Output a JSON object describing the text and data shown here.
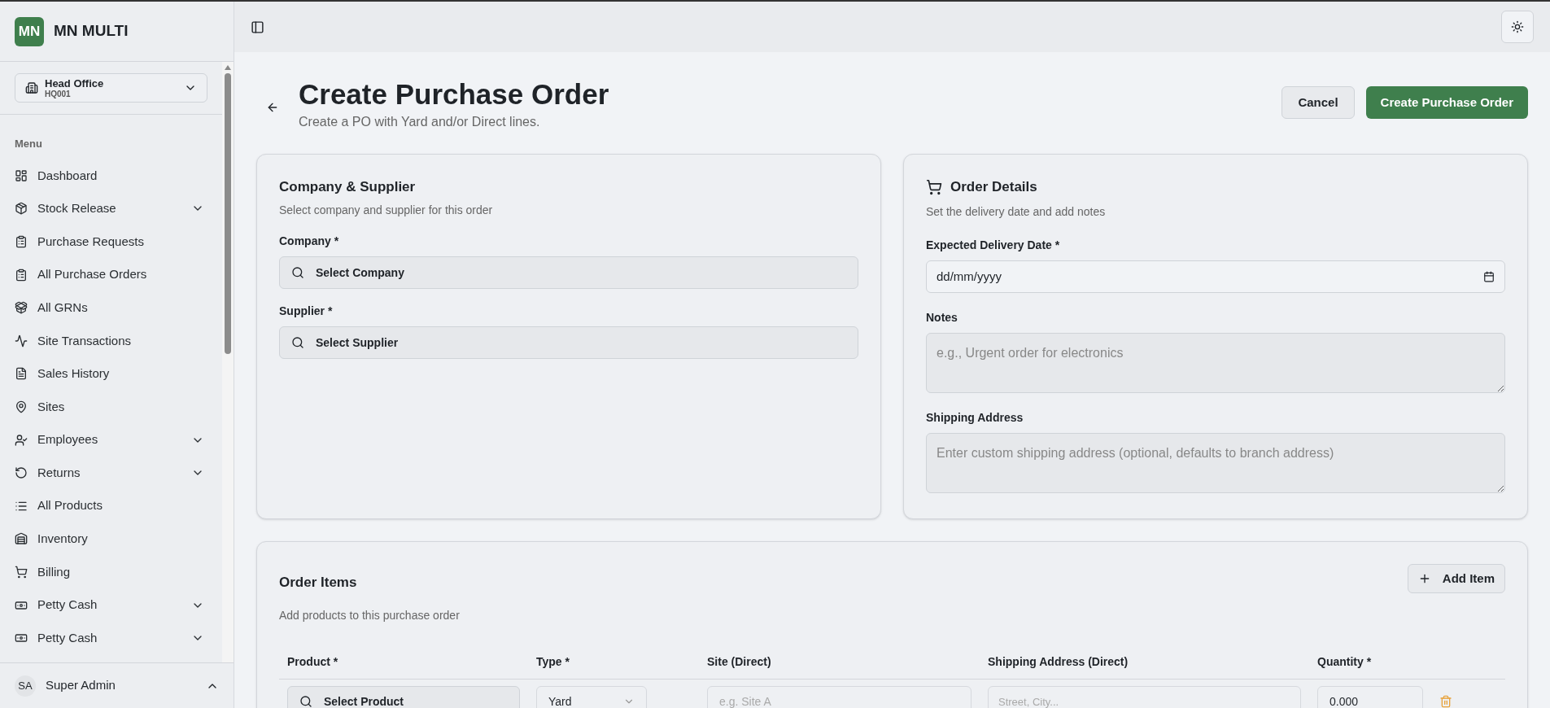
{
  "brand": {
    "logo": "MN",
    "name": "MN MULTI"
  },
  "branch": {
    "name": "Head Office",
    "code": "HQ001"
  },
  "sidebar": {
    "heading": "Menu",
    "items": [
      {
        "label": "Dashboard",
        "expandable": false
      },
      {
        "label": "Stock Release",
        "expandable": true
      },
      {
        "label": "Purchase Requests",
        "expandable": false
      },
      {
        "label": "All Purchase Orders",
        "expandable": false
      },
      {
        "label": "All GRNs",
        "expandable": false
      },
      {
        "label": "Site Transactions",
        "expandable": false
      },
      {
        "label": "Sales History",
        "expandable": false
      },
      {
        "label": "Sites",
        "expandable": false
      },
      {
        "label": "Employees",
        "expandable": true
      },
      {
        "label": "Returns",
        "expandable": true
      },
      {
        "label": "All Products",
        "expandable": false
      },
      {
        "label": "Inventory",
        "expandable": false
      },
      {
        "label": "Billing",
        "expandable": false
      },
      {
        "label": "Petty Cash",
        "expandable": true
      },
      {
        "label": "Petty Cash",
        "expandable": true
      }
    ]
  },
  "user": {
    "initials": "SA",
    "name": "Super Admin"
  },
  "page": {
    "title": "Create Purchase Order",
    "subtitle": "Create a PO with Yard and/or Direct lines.",
    "buttons": {
      "cancel": "Cancel",
      "submit": "Create Purchase Order"
    }
  },
  "company_card": {
    "title": "Company & Supplier",
    "description": "Select company and supplier for this order",
    "fields": [
      {
        "label": "Company *",
        "placeholder": "Select Company"
      },
      {
        "label": "Supplier *",
        "placeholder": "Select Supplier"
      }
    ]
  },
  "order_details": {
    "title": "Order Details",
    "description": "Set the delivery date and add notes",
    "date_label": "Expected Delivery Date *",
    "date_placeholder": "dd/mm/yyyy",
    "notes_label": "Notes",
    "notes_placeholder": "e.g., Urgent order for electronics",
    "shipping_label": "Shipping Address",
    "shipping_placeholder": "Enter custom shipping address (optional, defaults to branch address)"
  },
  "order_items": {
    "title": "Order Items",
    "description": "Add products to this purchase order",
    "add_button": "Add Item",
    "columns": [
      "Product *",
      "Type *",
      "Site (Direct)",
      "Shipping Address (Direct)",
      "Quantity *"
    ],
    "rows": [
      {
        "product_placeholder": "Select Product",
        "type": "Yard",
        "site_placeholder": "e.g. Site A",
        "address_placeholder": "Street, City...",
        "quantity": "0.000"
      }
    ]
  }
}
